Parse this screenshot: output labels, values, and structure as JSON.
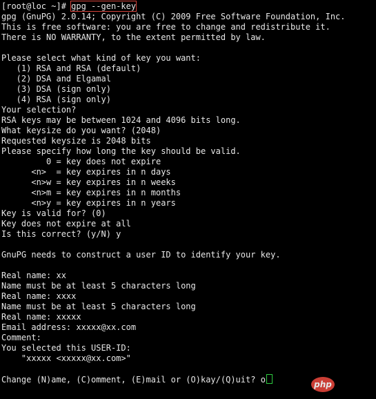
{
  "colors": {
    "background": "#000000",
    "text": "#e8e8e8",
    "highlight_box": "#d9443b",
    "cursor": "#2ecc40",
    "watermark": "#e1453b"
  },
  "terminal": {
    "prompt": "[root@loc ~]# ",
    "command": "gpg --gen-key",
    "lines": [
      "gpg (GnuPG) 2.0.14; Copyright (C) 2009 Free Software Foundation, Inc.",
      "This is free software: you are free to change and redistribute it.",
      "There is NO WARRANTY, to the extent permitted by law.",
      "",
      "Please select what kind of key you want:",
      "   (1) RSA and RSA (default)",
      "   (2) DSA and Elgamal",
      "   (3) DSA (sign only)",
      "   (4) RSA (sign only)",
      "Your selection?",
      "RSA keys may be between 1024 and 4096 bits long.",
      "What keysize do you want? (2048)",
      "Requested keysize is 2048 bits",
      "Please specify how long the key should be valid.",
      "         0 = key does not expire",
      "      <n>  = key expires in n days",
      "      <n>w = key expires in n weeks",
      "      <n>m = key expires in n months",
      "      <n>y = key expires in n years",
      "Key is valid for? (0)",
      "Key does not expire at all",
      "Is this correct? (y/N) y",
      "",
      "GnuPG needs to construct a user ID to identify your key.",
      "",
      "Real name: xx",
      "Name must be at least 5 characters long",
      "Real name: xxxx",
      "Name must be at least 5 characters long",
      "Real name: xxxxx",
      "Email address: xxxxx@xx.com",
      "Comment:",
      "You selected this USER-ID:",
      "    \"xxxxx <xxxxx@xx.com>\"",
      ""
    ],
    "last_prompt": "Change (N)ame, (C)omment, (E)mail or (O)kay/(Q)uit? ",
    "last_input": "o"
  },
  "watermark": {
    "text": "php"
  }
}
